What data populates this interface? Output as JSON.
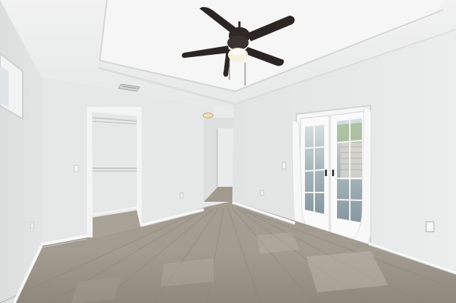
{
  "photo": {
    "subject": "empty-bedroom-interior",
    "palette": {
      "ceiling": "#eeefee",
      "tray_ceiling": "#f3f4f3",
      "wall_left": "#e3e4e4",
      "wall_back": "#e8e9e9",
      "wall_right": "#e6e7e7",
      "floor": "#9c968c",
      "floor_light": "#b4ada2",
      "baseboard": "#f7f7f7",
      "fan_dark": "#2b2624",
      "door_glass": "#9fb2b8",
      "greenery": "#9eb48f"
    },
    "icons": [
      "ceiling-fan-icon",
      "light-fixture-icon",
      "outlet-icon",
      "light-switch-icon",
      "vent-icon"
    ]
  }
}
